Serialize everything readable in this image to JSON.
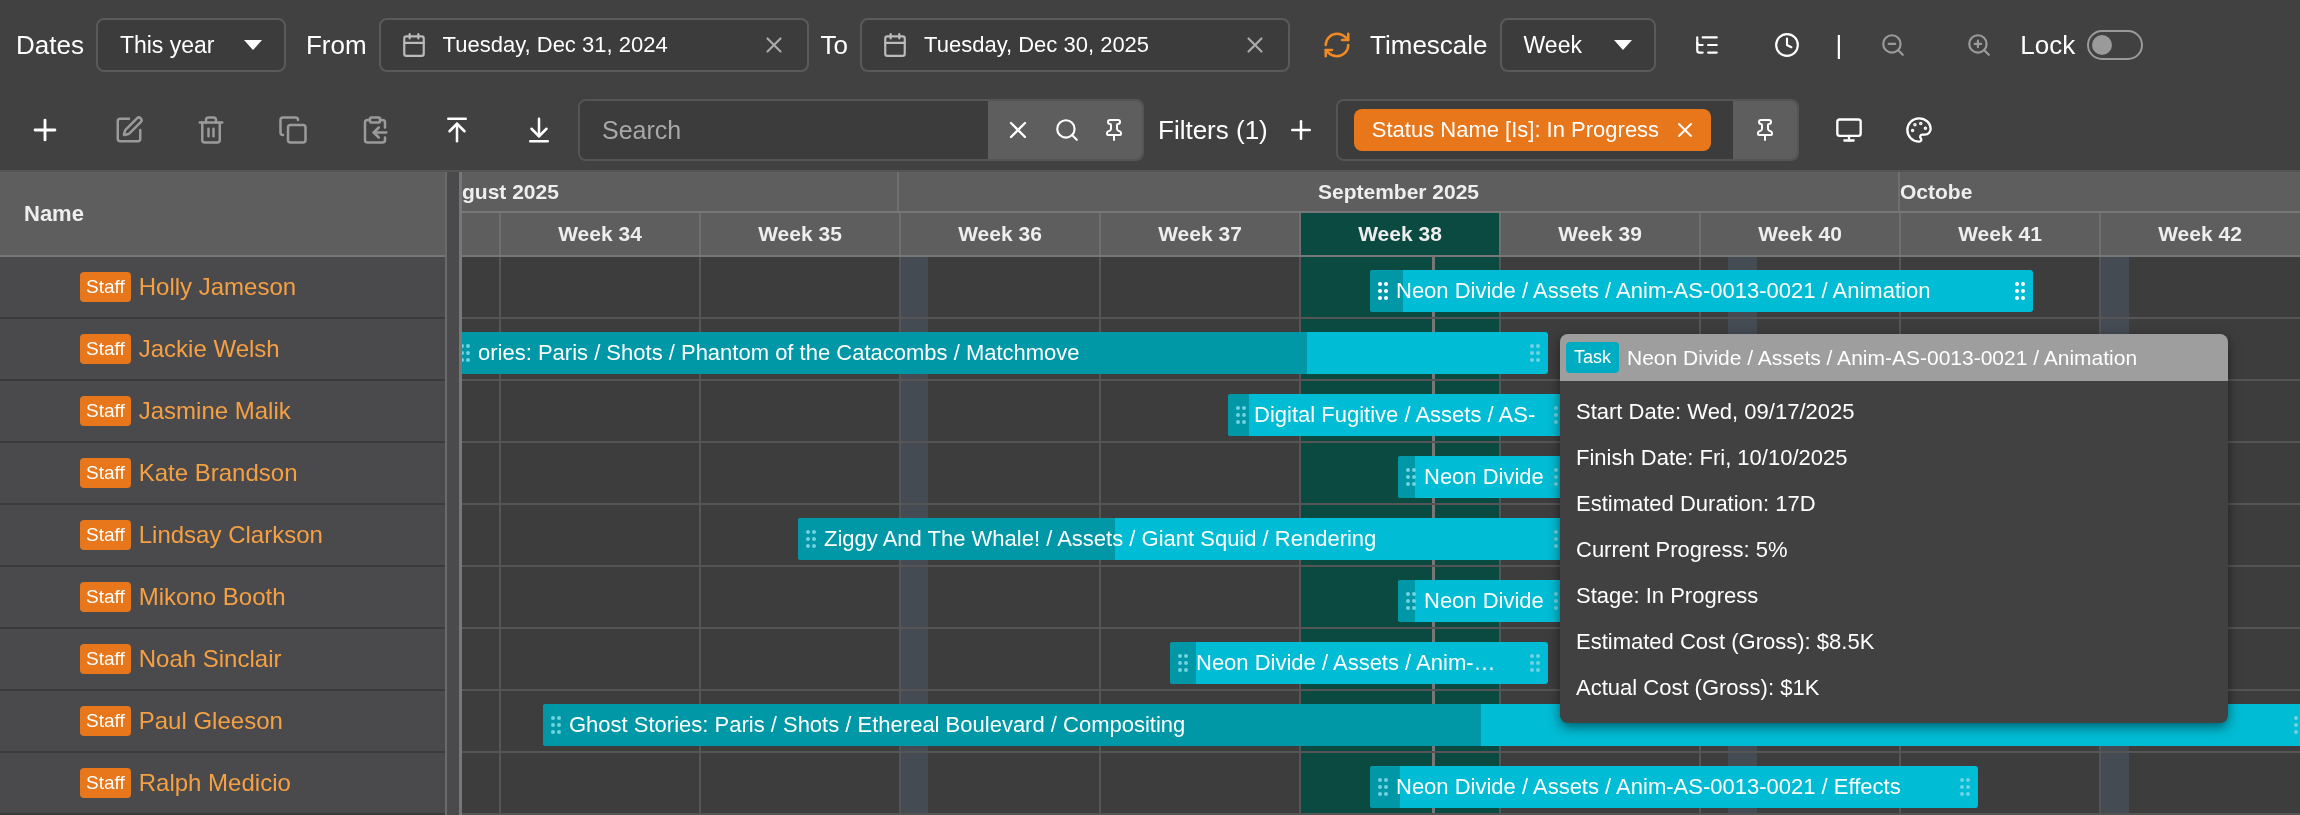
{
  "toolbar": {
    "dates_label": "Dates",
    "dates_range": "This year",
    "from_label": "From",
    "from_date": "Tuesday, Dec 31, 2024",
    "to_label": "To",
    "to_date": "Tuesday, Dec 30, 2025",
    "timescale_label": "Timescale",
    "timescale": "Week",
    "separator": "|",
    "lock_label": "Lock",
    "lock_on": false
  },
  "actions": {
    "search_placeholder": "Search",
    "filters_label": "Filters (1)",
    "filter_chips": [
      {
        "label": "Status Name [Is]: In Progress"
      }
    ]
  },
  "grid": {
    "name_column": "Name",
    "months": [
      {
        "label": "gust 2025"
      },
      {
        "label": "September 2025"
      },
      {
        "label": "Octobe"
      }
    ],
    "weeks": [
      {
        "label": "Week 34",
        "highlighted": false
      },
      {
        "label": "Week 35",
        "highlighted": false
      },
      {
        "label": "Week 36",
        "highlighted": false
      },
      {
        "label": "Week 37",
        "highlighted": false
      },
      {
        "label": "Week 38",
        "highlighted": true
      },
      {
        "label": "Week 39",
        "highlighted": false
      },
      {
        "label": "Week 40",
        "highlighted": false
      },
      {
        "label": "Week 41",
        "highlighted": false
      },
      {
        "label": "Week 42",
        "highlighted": false
      }
    ],
    "rows": [
      {
        "tag": "Staff",
        "name": "Holly Jameson",
        "bar": {
          "label": "Neon Divide / Assets / Anim-AS-0013-0021 / Animation",
          "level": 0.05,
          "hovered": true
        }
      },
      {
        "tag": "Staff",
        "name": "Jackie Welsh",
        "bar": {
          "label": "ories: Paris / Shots / Phantom of the Catacombs / Matchmove",
          "level": 0.78,
          "hovered": false
        }
      },
      {
        "tag": "Staff",
        "name": "Jasmine Malik",
        "bar": {
          "label": "Digital Fugitive / Assets / AS-",
          "level": 0.06,
          "hovered": false
        }
      },
      {
        "tag": "Staff",
        "name": "Kate Brandson",
        "bar": {
          "label": "Neon Divide",
          "level": 0.1,
          "hovered": false
        }
      },
      {
        "tag": "Staff",
        "name": "Lindsay Clarkson",
        "bar": {
          "label": "Ziggy And The Whale! / Assets / Giant Squid / Rendering",
          "level": 0.41,
          "hovered": false
        }
      },
      {
        "tag": "Staff",
        "name": "Mikono Booth",
        "bar": {
          "label": "Neon Divide",
          "level": 0.1,
          "hovered": false
        }
      },
      {
        "tag": "Staff",
        "name": "Noah Sinclair",
        "bar": {
          "label": "Neon Divide / Assets / Anim-…",
          "level": 0.07,
          "hovered": false
        }
      },
      {
        "tag": "Staff",
        "name": "Paul Gleeson",
        "bar": {
          "label": "Ghost Stories: Paris / Shots / Ethereal Boulevard / Compositing",
          "level": 0.53,
          "hovered": false
        }
      },
      {
        "tag": "Staff",
        "name": "Ralph Medicio",
        "bar": {
          "label": "Neon Divide / Assets / Anim-AS-0013-0021 / Effects",
          "level": 0.05,
          "hovered": false
        }
      }
    ]
  },
  "tooltip": {
    "badge": "Task",
    "title": "Neon Divide / Assets / Anim-AS-0013-0021 / Animation",
    "lines": [
      "Start Date: Wed, 09/17/2025",
      "Finish Date: Fri, 10/10/2025",
      "Estimated Duration: 17D",
      "Current Progress: 5%",
      "Stage: In Progress",
      "Estimated Cost (Gross): $8.5K",
      "Actual Cost (Gross): $1K"
    ]
  }
}
